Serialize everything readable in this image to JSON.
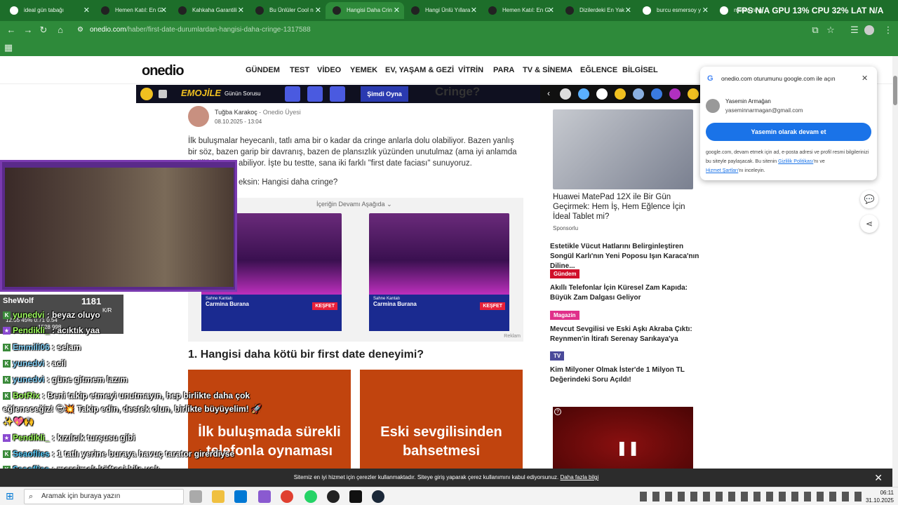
{
  "tabs": [
    {
      "label": "ideal gün tabağı",
      "active": false
    },
    {
      "label": "Hemen Katıl: En G",
      "active": false
    },
    {
      "label": "Kahkaha Garantili",
      "active": false
    },
    {
      "label": "Bu Ünlüler Cool n",
      "active": false
    },
    {
      "label": "Hangisi Daha Crin",
      "active": true
    },
    {
      "label": "Hangi Ünlü Yıllara",
      "active": false
    },
    {
      "label": "Hemen Katıl: En G",
      "active": false
    },
    {
      "label": "Dizilerdeki En Yak",
      "active": false
    },
    {
      "label": "burcu esmersoy y",
      "active": false
    },
    {
      "label": "melisa nil gulbit",
      "active": false
    }
  ],
  "perf_overlay": "FPS N/A   GPU 13%   CPU 32%   LAT N/A",
  "url": {
    "domain": "onedio.com",
    "path": "/haber/first-date-durumlardan-hangisi-daha-cringe-1317588"
  },
  "site": {
    "logo": "onedio",
    "nav": [
      "GÜNDEM",
      "TEST",
      "VİDEO",
      "YEMEK",
      "EV, YAŞAM & GEZİ",
      "VİTRİN",
      "PARA",
      "TV & SİNEMA",
      "EĞLENCE",
      "BİLGİSEL"
    ]
  },
  "emojile": {
    "brand": "EMOJİLE",
    "label": "Günün Sorusu",
    "play": "Şimdi Oyna",
    "title_fragment": "Cringe?"
  },
  "author": {
    "name": "Tuğba Karakoç",
    "role": "Onedio Üyesi",
    "date": "08.10.2025 - 13:04"
  },
  "article": {
    "p1": "İlk buluşmalar heyecanlı, tatlı ama bir o kadar da cringe anlarla dolu olabiliyor. Bazen yanlış bir söz, bazen garip bir davranış, bazen de plansızlık yüzünden unutulmaz (ama iyi anlamda değil!) bir",
    "p1b": "abiliyor. İşte bu testte, sana iki farklı \"first date faciası\" sunuyoruz.",
    "p2": "eksin: Hangisi daha cringe?",
    "continue": "İçeriğin Devamı Aşağıda",
    "ad_label": "Reklam",
    "ad_title": "Carmina Burana",
    "ad_sub": "Sahne Kantatı",
    "ad_cta": "KEŞFET",
    "q1": "1. Hangisi daha kötü bir first date deneyimi?",
    "answer1": "İlk buluşmada sürekli telefonla oynaması",
    "answer2": "Eski sevgilisinden bahsetmesi"
  },
  "right": {
    "sponsor_title": "Huawei MatePad 12X ile Bir Gün Geçirmek: Hem İş, Hem Eğlence İçin İdeal Tablet mi?",
    "sponsor_label": "Sponsorlu",
    "items": [
      {
        "badge": "",
        "badge_color": "",
        "text": "Estetikle Vücut Hatlarını Belirginleştiren Songül Karlı'nın Yeni Poposu Işın Karaca'nın Diline..."
      },
      {
        "badge": "Gündem",
        "badge_color": "#d0102a",
        "text": "Akıllı Telefonlar İçin Küresel Zam Kapıda: Büyük Zam Dalgası Geliyor"
      },
      {
        "badge": "Magazin",
        "badge_color": "#e0308a",
        "text": "Mevcut Sevgilisi ve Eski Aşkı Akraba Çıktı: Reynmen'in İtirafı Serenay Sarıkaya'ya Büyük..."
      },
      {
        "badge": "TV",
        "badge_color": "#4a4a9a",
        "text": "Kim Milyoner Olmak İster'de 1 Milyon TL Değerindeki Soru Açıldı!"
      }
    ]
  },
  "google_popup": {
    "title": "onedio.com oturumunu google.com ile açın",
    "name": "Yasemin Armağan",
    "email": "yaseminnarmagan@gmail.com",
    "button": "Yasemin olarak devam et",
    "footer1": "google.com, devam etmek için ad, e-posta adresi ve profil resmi bilgilerinizi bu siteyle paylaşacak. Bu sitenin",
    "privacy": "Gizlilik Politikası",
    "and": "'nı ve",
    "terms": "Hizmet Şartları",
    "footer2": "'nı inceleyin."
  },
  "stream": {
    "score_name": "SheWolf",
    "score_value": "1181",
    "score_sub1": "12.65   45%   0.71   0.54",
    "score_sub2": "1528 998",
    "score_kr": "K/R",
    "chat": [
      {
        "user": "yunedvi",
        "msg": "beyaz oluyo"
      },
      {
        "user": "Pendikli_",
        "msg": "acıktık yaa"
      },
      {
        "user": "Emmili06",
        "msg": "selam"
      },
      {
        "user": "yunedvi",
        "msg": "acil"
      },
      {
        "user": "yunedvi",
        "msg": "güne gitmem lazım"
      },
      {
        "user": "BotRix",
        "msg": "Beni takip etmeyi unutmayın, hep birlikte daha çok"
      },
      {
        "user": "",
        "msg": "eğleneceğiz! 😎💥 Takip edin, destek olun, birlikte büyüyelim! 🚀"
      },
      {
        "user": "",
        "msg": "✨💖🙌"
      },
      {
        "user": "Pendikli_",
        "msg": "kızılcık turşusu gibi"
      },
      {
        "user": "Seaoflies",
        "msg": "1 tatlı yerine buraya havuç tarator girerdiyse"
      },
      {
        "user": "Seaoflies",
        "msg": "mercimek köftesi bile yok"
      }
    ]
  },
  "cookie": {
    "text": "Sitemiz en iyi hizmet için çerezler kullanmaktadır. Siteye giriş yaparak çerez kullanımını kabul ediyorsunuz.",
    "link": "Daha fazla bilgi"
  },
  "taskbar": {
    "search_placeholder": "Aramak için buraya yazın",
    "time": "06:11",
    "date": "31.10.2025"
  }
}
